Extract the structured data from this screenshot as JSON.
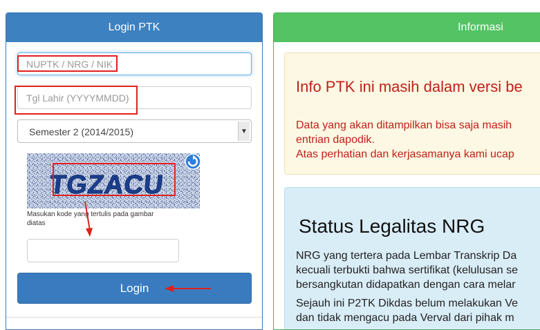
{
  "login_panel": {
    "title": "Login PTK",
    "nuptk_placeholder": "NUPTK / NRG / NIK",
    "birthdate_placeholder": "Tgl Lahir (YYYYMMDD)",
    "semester_selected": "Semester 2 (2014/2015)",
    "captcha_text": "TGZACU",
    "captcha_note": "Masukan kode yang tertulis pada gambar diatas",
    "code_value": "",
    "login_label": "Login"
  },
  "info_panel": {
    "title": "Informasi",
    "warning": {
      "heading": "Info PTK ini masih dalam versi be",
      "lines": [
        "Data yang akan ditampilkan bisa saja masih",
        "entrian dapodik.",
        "Atas perhatian dan kerjasamanya kami ucap"
      ]
    },
    "status": {
      "heading": "Status Legalitas NRG",
      "lines": [
        "NRG yang tertera pada Lembar Transkrip Da",
        "kecuali terbukti bahwa sertifikat (kelulusan se",
        "bersangkutan didapatkan dengan cara melar",
        "Sejauh ini P2TK Dikdas belum melakukan Ve",
        "dan tidak mengacu pada Verval dari pihak m"
      ]
    }
  },
  "colors": {
    "primary_blue": "#3d81c0",
    "success_green": "#53c364",
    "warning_text": "#c1201a",
    "annotation_red": "#e0201d"
  },
  "icons": {
    "refresh": "refresh-icon",
    "select_arrow": "chevron-down-icon"
  }
}
